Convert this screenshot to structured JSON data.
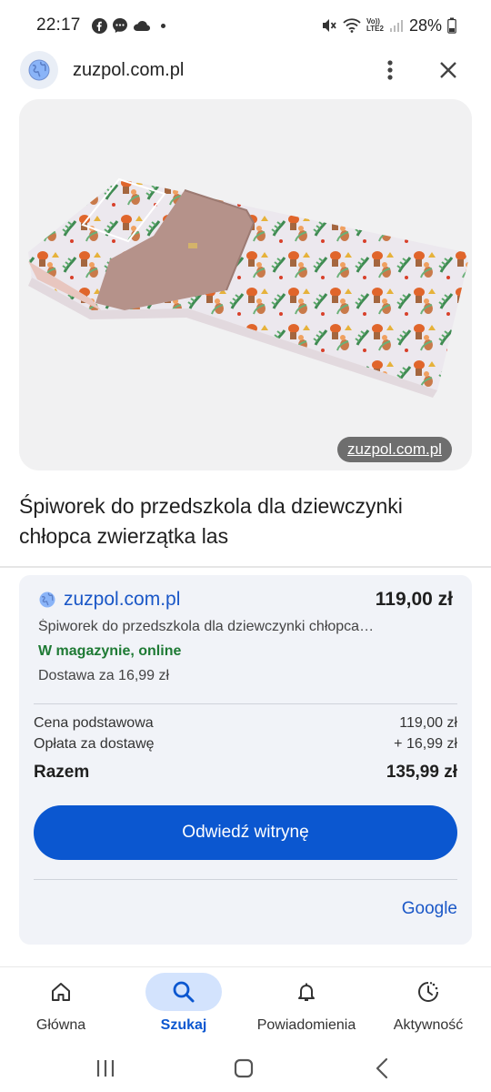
{
  "status_bar": {
    "time": "22:17",
    "battery": "28%",
    "network_label_top": "Vo))",
    "network_label_bottom": "LTE2",
    "icons_left": [
      "facebook-icon",
      "messenger-icon",
      "cloud-icon",
      "dot-icon"
    ],
    "icons_right": [
      "mute-icon",
      "wifi-icon",
      "signal-icon",
      "battery-icon"
    ]
  },
  "header": {
    "domain": "zuzpol.com.pl",
    "menu_icon": "more-vertical-icon",
    "close_icon": "close-icon"
  },
  "image": {
    "source_chip": "zuzpol.com.pl"
  },
  "product": {
    "title": "Śpiworek do przedszkola dla dziewczynki chłopca zwierzątka las"
  },
  "offer": {
    "merchant": "zuzpol.com.pl",
    "price": "119,00 zł",
    "description": "Śpiworek do przedszkola dla dziewczynki chłopca…",
    "stock": "W magazynie, online",
    "delivery": "Dostawa za 16,99 zł",
    "base_price_label": "Cena podstawowa",
    "base_price_value": "119,00 zł",
    "shipping_label": "Opłata za dostawę",
    "shipping_value": "+ 16,99 zł",
    "total_label": "Razem",
    "total_value": "135,99 zł",
    "visit_button": "Odwiedź witrynę",
    "google_link": "Google"
  },
  "colors": {
    "accent": "#0b57d0",
    "link": "#1a57c7",
    "stock_green": "#1e7a34",
    "card_bg": "#f1f3f8",
    "nav_active_pill": "#d3e3fd"
  },
  "bottom_nav": {
    "items": [
      {
        "label": "Główna",
        "icon": "home-icon",
        "active": false
      },
      {
        "label": "Szukaj",
        "icon": "search-icon",
        "active": true
      },
      {
        "label": "Powiadomienia",
        "icon": "bell-icon",
        "active": false
      },
      {
        "label": "Aktywność",
        "icon": "activity-icon",
        "active": false
      }
    ]
  },
  "system_nav": {
    "icons": [
      "recent-apps-icon",
      "home-button-icon",
      "back-icon"
    ]
  }
}
